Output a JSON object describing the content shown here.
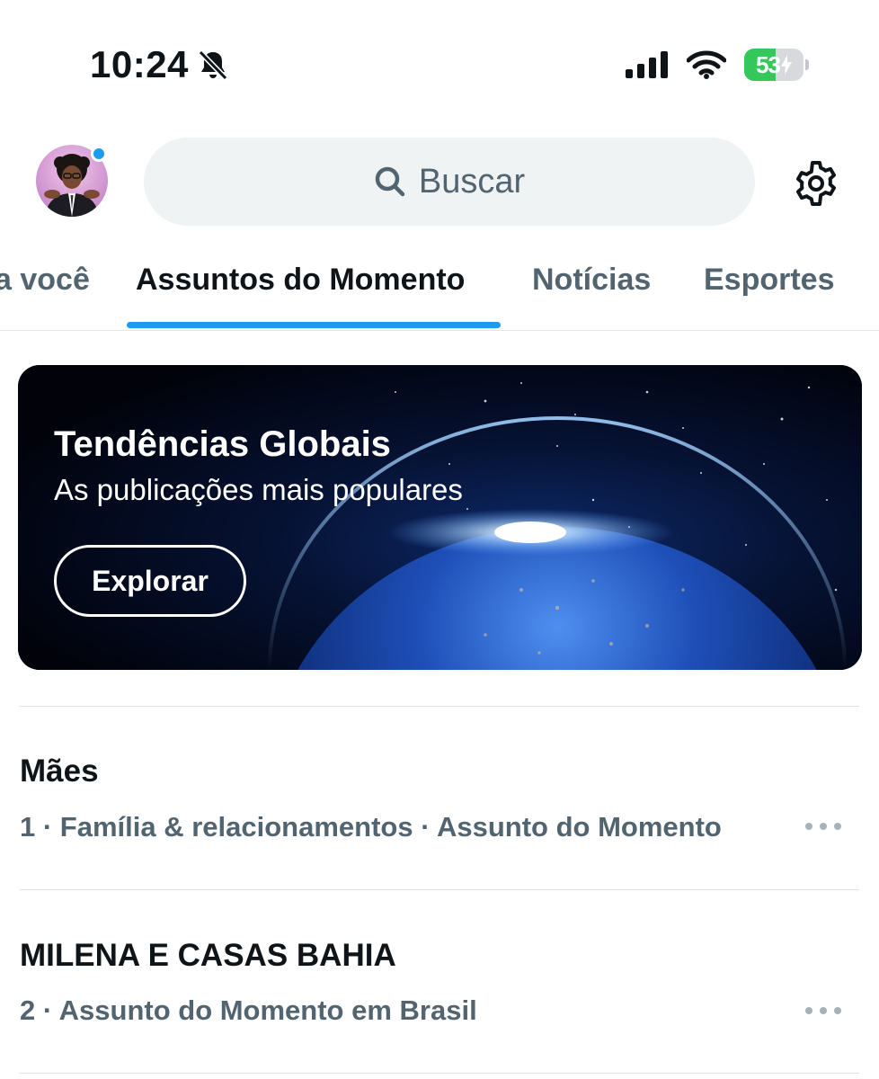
{
  "status_bar": {
    "time": "10:24",
    "battery_level": "53",
    "battery_fraction": 0.53,
    "icons": [
      "bell-slash-icon",
      "cellular-signal-icon",
      "wifi-icon",
      "battery-charging-icon"
    ]
  },
  "header": {
    "search_placeholder": "Buscar",
    "icons": [
      "search-icon",
      "gear-icon"
    ]
  },
  "tabs": [
    {
      "label": "a você"
    },
    {
      "label": "Assuntos do Momento",
      "active": true
    },
    {
      "label": "Notícias"
    },
    {
      "label": "Esportes"
    }
  ],
  "banner": {
    "title": "Tendências Globais",
    "subtitle": "As publicações mais populares",
    "button_label": "Explorar"
  },
  "trends": [
    {
      "title": "Mães",
      "meta": "1 · Família & relacionamentos · Assunto do Momento"
    },
    {
      "title": "MILENA E CASAS BAHIA",
      "meta": "2 · Assunto do Momento em Brasil"
    }
  ],
  "colors": {
    "accent": "#1d9bf0",
    "secondary_text": "#536471",
    "battery_green": "#34c759"
  }
}
